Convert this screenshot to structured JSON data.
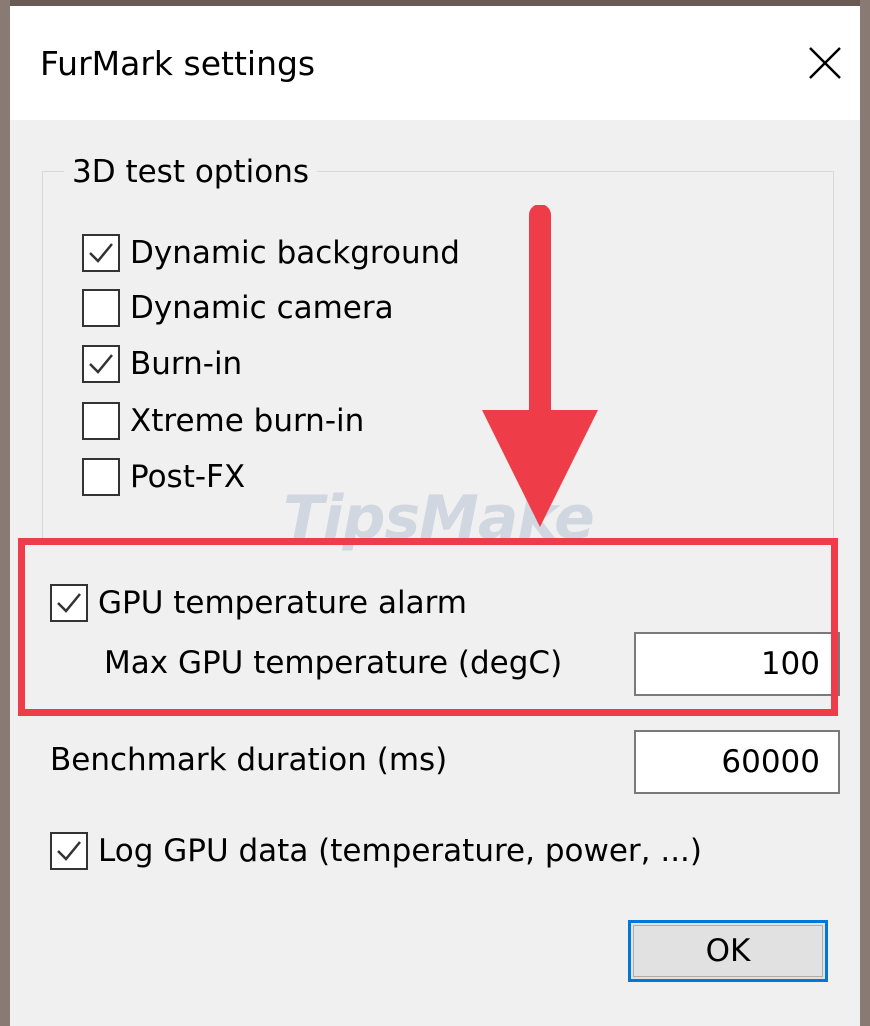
{
  "window": {
    "title": "FurMark settings"
  },
  "test_options": {
    "group_title": "3D test options",
    "items": [
      {
        "label": "Dynamic background",
        "checked": true
      },
      {
        "label": "Dynamic camera",
        "checked": false
      },
      {
        "label": "Burn-in",
        "checked": true
      },
      {
        "label": "Xtreme burn-in",
        "checked": false
      },
      {
        "label": "Post-FX",
        "checked": false
      }
    ]
  },
  "gpu_alarm": {
    "label": "GPU temperature alarm",
    "checked": true,
    "max_temp_label": "Max GPU temperature (degC)",
    "max_temp_value": "100"
  },
  "benchmark": {
    "label": "Benchmark duration (ms)",
    "value": "60000"
  },
  "log_gpu": {
    "label": "Log GPU data (temperature, power, ...)",
    "checked": true
  },
  "buttons": {
    "ok": "OK"
  },
  "annotation": {
    "highlight_color": "#ee3d49"
  },
  "watermark": {
    "text": "TipsMake"
  }
}
